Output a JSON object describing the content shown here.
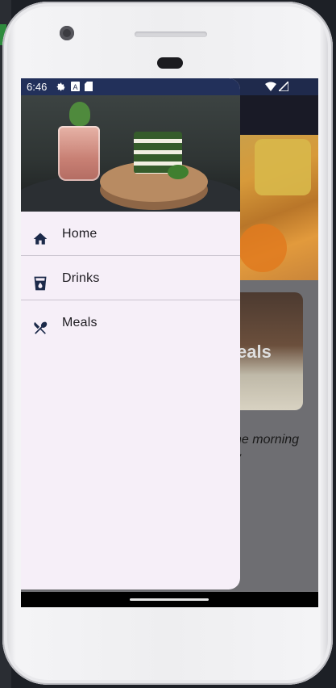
{
  "status_bar": {
    "time": "6:46",
    "icons": [
      "settings-icon",
      "a-icon",
      "sd-card-icon"
    ],
    "right_icons": [
      "wifi-icon",
      "signal-icon"
    ]
  },
  "drawer": {
    "items": [
      {
        "label": "Home",
        "icon": "home-icon"
      },
      {
        "label": "Drinks",
        "icon": "cup-icon"
      },
      {
        "label": "Meals",
        "icon": "utensils-icon"
      }
    ]
  },
  "background_screen": {
    "card_label": "eals",
    "quote_line1": "he morning",
    "quote_line2": "y"
  },
  "colors": {
    "app_bar": "#191a26",
    "drawer_bg": "#f6eff8",
    "icon": "#1c2a4a",
    "status_bar": "#1f2a4c"
  }
}
